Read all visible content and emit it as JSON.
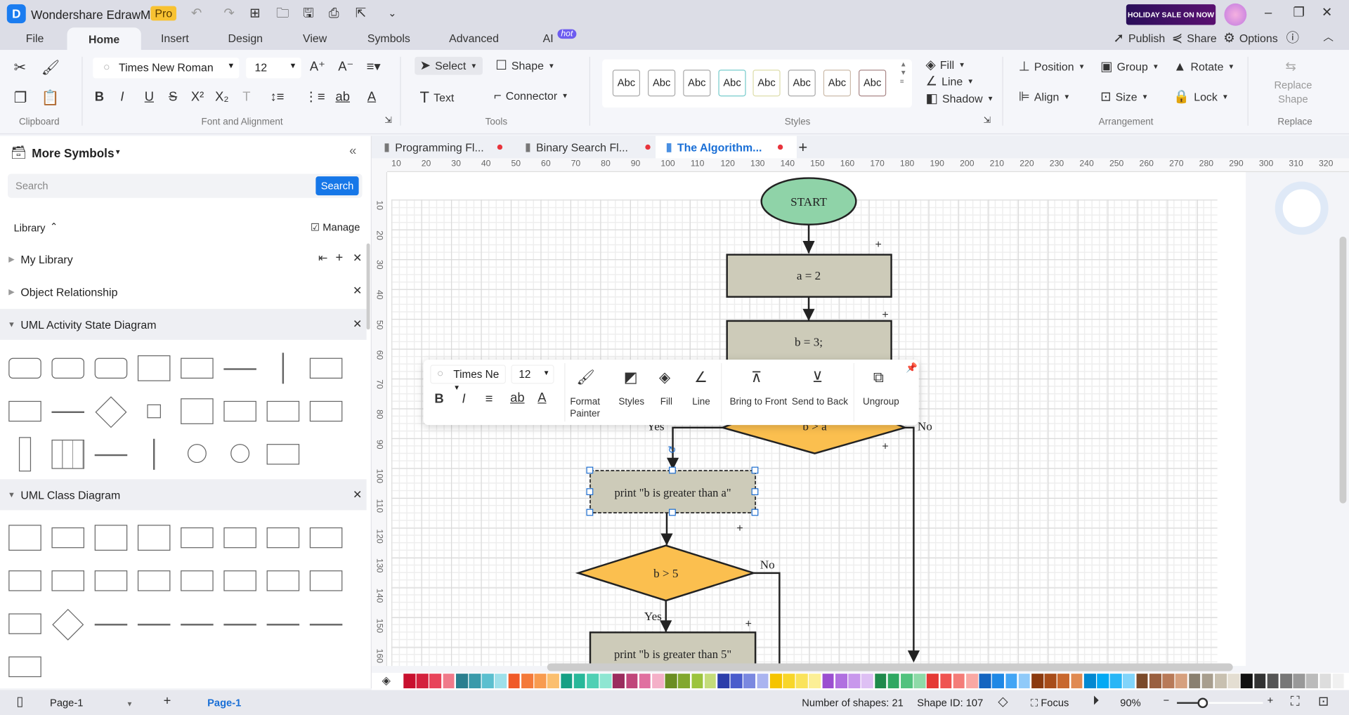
{
  "app": {
    "title": "Wondershare EdrawMax",
    "badge": "Pro",
    "promo": "HOLIDAY SALE ON NOW"
  },
  "menu": {
    "tabs": [
      "File",
      "Home",
      "Insert",
      "Design",
      "View",
      "Symbols",
      "Advanced",
      "AI"
    ],
    "ai_badge": "hot",
    "active": "Home",
    "right": {
      "publish": "Publish",
      "share": "Share",
      "options": "Options"
    }
  },
  "ribbon": {
    "clipboard_label": "Clipboard",
    "font": {
      "family": "Times New Roman",
      "size": "12",
      "label": "Font and Alignment"
    },
    "tools": {
      "select": "Select",
      "shape": "Shape",
      "text": "Text",
      "connector": "Connector",
      "label": "Tools"
    },
    "styles": {
      "swatches": [
        "Abc",
        "Abc",
        "Abc",
        "Abc",
        "Abc",
        "Abc",
        "Abc",
        "Abc"
      ],
      "fill": "Fill",
      "line": "Line",
      "shadow": "Shadow",
      "label": "Styles"
    },
    "arrangement": {
      "position": "Position",
      "group": "Group",
      "rotate": "Rotate",
      "align": "Align",
      "size": "Size",
      "lock": "Lock",
      "label": "Arrangement"
    },
    "replace": {
      "button": "Replace Shape",
      "label": "Replace"
    }
  },
  "left_panel": {
    "title": "More Symbols",
    "search_placeholder": "Search",
    "search_button": "Search",
    "library": "Library",
    "manage": "Manage",
    "libraries": [
      "My Library",
      "Object Relationship",
      "UML Activity State Diagram",
      "UML Class Diagram"
    ]
  },
  "doc_tabs": [
    {
      "label": "Programming Fl...",
      "active": false
    },
    {
      "label": "Binary Search Fl...",
      "active": false
    },
    {
      "label": "The Algorithm...",
      "active": true
    }
  ],
  "rulers": {
    "top": [
      "10",
      "20",
      "30",
      "40",
      "50",
      "60",
      "70",
      "80",
      "90",
      "100",
      "110",
      "120",
      "130",
      "140",
      "150",
      "160",
      "170",
      "180",
      "190",
      "200",
      "210",
      "220",
      "230",
      "240",
      "250",
      "260",
      "270",
      "280",
      "290",
      "300",
      "310",
      "320"
    ],
    "left": [
      "10",
      "20",
      "30",
      "40",
      "50",
      "60",
      "70",
      "80",
      "90",
      "100",
      "110",
      "120",
      "130",
      "140",
      "150",
      "160"
    ]
  },
  "flowchart": {
    "start": "START",
    "step1": "a = 2",
    "step2": "b = 3;",
    "decision1": "b > a",
    "print1": "print \"b is greater than a\"",
    "decision2": "b > 5",
    "print2": "print \"b is greater than 5\"",
    "yes": "Yes",
    "no": "No",
    "colors": {
      "terminal": "#8fd3a8",
      "process": "#cdcbb9",
      "decision": "#fbbf4f",
      "selection": "#1f6fd1"
    }
  },
  "floating_toolbar": {
    "font": "Times Ne",
    "size": "12",
    "format_painter": "Format Painter",
    "styles": "Styles",
    "fill": "Fill",
    "line": "Line",
    "bring_front": "Bring to Front",
    "send_back": "Send to Back",
    "ungroup": "Ungroup"
  },
  "palette": [
    "#c8102e",
    "#d4213d",
    "#e8445a",
    "#f07a8a",
    "#2a7f8f",
    "#3a9aaa",
    "#5bbfcf",
    "#9ee0ea",
    "#f05a28",
    "#f47a3a",
    "#f89b4f",
    "#fbbf6f",
    "#15a085",
    "#28b89a",
    "#4fd0b4",
    "#8ee6d2",
    "#9b2c5e",
    "#c0457a",
    "#e070a0",
    "#f4b0c8",
    "#6b8e23",
    "#82a82e",
    "#9cc43e",
    "#c4dc7a",
    "#2c3eaa",
    "#4a5ccc",
    "#7a88e0",
    "#aab4f0",
    "#f5c400",
    "#f8d62a",
    "#fae35a",
    "#fcef96",
    "#9b4fd0",
    "#b070e0",
    "#c898ec",
    "#dec0f4",
    "#1f8a4c",
    "#2fa862",
    "#52c27e",
    "#8edaa8",
    "#e53935",
    "#ef5350",
    "#f47c78",
    "#f9a8a4",
    "#1565c0",
    "#1e88e5",
    "#42a5f5",
    "#90caf9",
    "#8b3a0f",
    "#a84d1a",
    "#c8682e",
    "#e08a52",
    "#0288d1",
    "#03a9f4",
    "#29b6f6",
    "#81d4fa",
    "#7b4a2a",
    "#9a6040",
    "#b87a58",
    "#d6a07e",
    "#8a8070",
    "#a89e8e",
    "#c8c0b0",
    "#e4ded2",
    "#111111",
    "#333333",
    "#555555",
    "#777777",
    "#999999",
    "#bbbbbb",
    "#dddddd",
    "#f0f0f0"
  ],
  "status": {
    "page_select": "Page-1",
    "page_tab": "Page-1",
    "shape_count": "Number of shapes: 21",
    "shape_id": "Shape ID: 107",
    "focus": "Focus",
    "zoom": "90%",
    "zoom_level": 0.3
  }
}
